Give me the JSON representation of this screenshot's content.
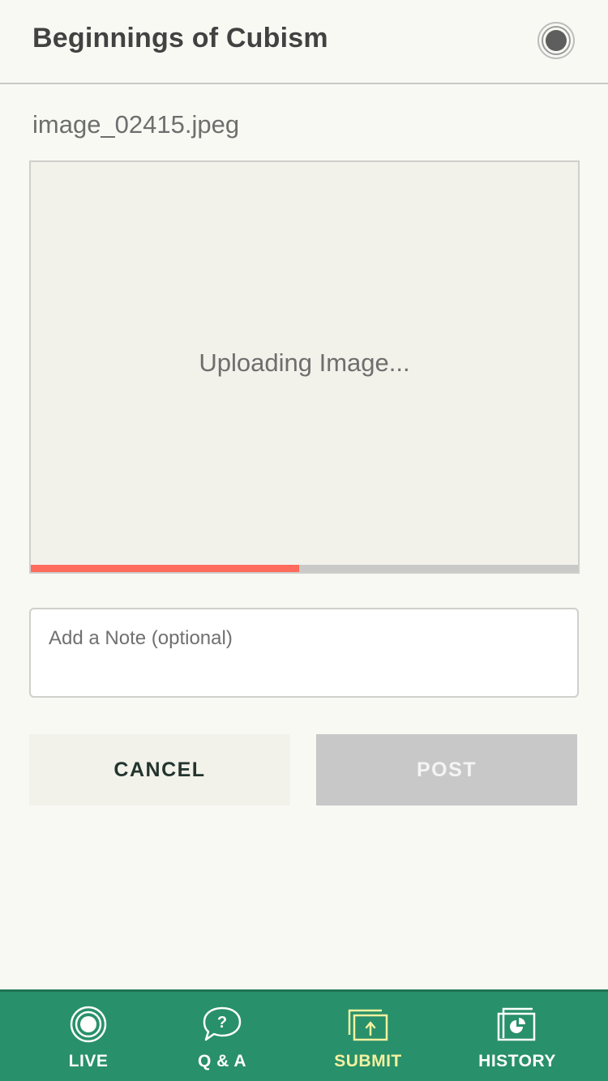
{
  "header": {
    "title": "Beginnings of Cubism",
    "live_icon": "record-icon"
  },
  "upload": {
    "filename": "image_02415.jpeg",
    "status": "Uploading Image...",
    "progress": 0.49,
    "progress_color": "#ff6b5d"
  },
  "note": {
    "placeholder": "Add a Note (optional)",
    "value": ""
  },
  "actions": {
    "cancel_label": "CANCEL",
    "post_label": "POST"
  },
  "tabbar": {
    "background": "#28906a",
    "active_color": "#f4f1a0",
    "tabs": [
      {
        "label": "LIVE",
        "icon": "live-icon",
        "active": false
      },
      {
        "label": "Q & A",
        "icon": "question-bubble-icon",
        "active": false
      },
      {
        "label": "SUBMIT",
        "icon": "upload-icon",
        "active": true
      },
      {
        "label": "HISTORY",
        "icon": "history-icon",
        "active": false
      }
    ]
  }
}
